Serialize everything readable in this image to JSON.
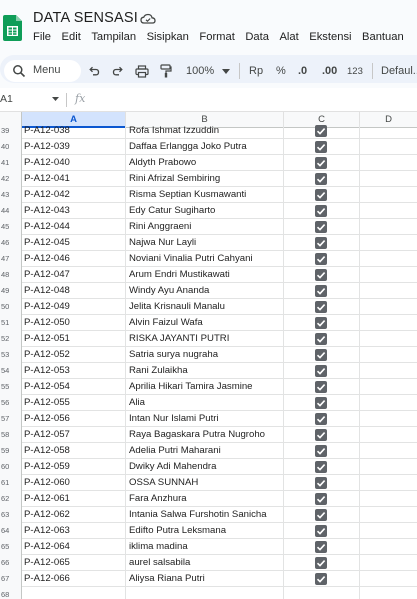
{
  "app": {
    "title": "DATA SENSASI",
    "menu": [
      "File",
      "Edit",
      "Tampilan",
      "Sisipkan",
      "Format",
      "Data",
      "Alat",
      "Ekstensi",
      "Bantuan"
    ]
  },
  "toolbar": {
    "search_label": "Menu",
    "zoom": "100%",
    "currency": "Rp",
    "percent": "%",
    "dec_decrease": ".0",
    "dec_increase": ".00",
    "number_format": "123",
    "font": "Defaul..."
  },
  "formula_bar": {
    "name_box": "A1",
    "fx": "fx"
  },
  "columns": [
    "A",
    "B",
    "C",
    "D"
  ],
  "selected_column": "A",
  "colors": {
    "accent": "#0b57d0",
    "checkbox": "#5f6368",
    "header_bg": "#f8f9fa",
    "logo_green": "#0f9d58"
  },
  "rows": [
    {
      "num": "39",
      "code": "P-A12-038",
      "name": "Rofa Ishmat Izzuddin",
      "checked": true
    },
    {
      "num": "40",
      "code": "P-A12-039",
      "name": "Daffaa Erlangga Joko Putra",
      "checked": true
    },
    {
      "num": "41",
      "code": "P-A12-040",
      "name": "Aldyth Prabowo",
      "checked": true
    },
    {
      "num": "42",
      "code": "P-A12-041",
      "name": "Rini Afrizal Sembiring",
      "checked": true
    },
    {
      "num": "43",
      "code": "P-A12-042",
      "name": "Risma Septian Kusmawanti",
      "checked": true
    },
    {
      "num": "44",
      "code": "P-A12-043",
      "name": "Edy Catur Sugiharto",
      "checked": true
    },
    {
      "num": "45",
      "code": "P-A12-044",
      "name": "Rini Anggraeni",
      "checked": true
    },
    {
      "num": "46",
      "code": "P-A12-045",
      "name": "Najwa Nur Layli",
      "checked": true
    },
    {
      "num": "47",
      "code": "P-A12-046",
      "name": "Noviani Vinalia Putri Cahyani",
      "checked": true
    },
    {
      "num": "48",
      "code": "P-A12-047",
      "name": "Arum Endri Mustikawati",
      "checked": true
    },
    {
      "num": "49",
      "code": "P-A12-048",
      "name": "Windy Ayu Ananda",
      "checked": true
    },
    {
      "num": "50",
      "code": "P-A12-049",
      "name": "Jelita Krisnauli Manalu",
      "checked": true
    },
    {
      "num": "51",
      "code": "P-A12-050",
      "name": "Alvin Faizul Wafa",
      "checked": true
    },
    {
      "num": "52",
      "code": "P-A12-051",
      "name": "RISKA JAYANTI PUTRI",
      "checked": true
    },
    {
      "num": "53",
      "code": "P-A12-052",
      "name": "Satria surya nugraha",
      "checked": true
    },
    {
      "num": "54",
      "code": "P-A12-053",
      "name": "Rani Zulaikha",
      "checked": true
    },
    {
      "num": "55",
      "code": "P-A12-054",
      "name": "Aprilia Hikari Tamira Jasmine",
      "checked": true
    },
    {
      "num": "56",
      "code": "P-A12-055",
      "name": "Alia",
      "checked": true
    },
    {
      "num": "57",
      "code": "P-A12-056",
      "name": "Intan Nur Islami Putri",
      "checked": true
    },
    {
      "num": "58",
      "code": "P-A12-057",
      "name": "Raya Bagaskara Putra Nugroho",
      "checked": true
    },
    {
      "num": "59",
      "code": "P-A12-058",
      "name": "Adelia Putri Maharani",
      "checked": true
    },
    {
      "num": "60",
      "code": "P-A12-059",
      "name": "Dwiky Adi Mahendra",
      "checked": true
    },
    {
      "num": "61",
      "code": "P-A12-060",
      "name": "OSSA SUNNAH",
      "checked": true
    },
    {
      "num": "62",
      "code": "P-A12-061",
      "name": "Fara Anzhura",
      "checked": true
    },
    {
      "num": "63",
      "code": "P-A12-062",
      "name": "Intania Salwa Furshotin Sanicha",
      "checked": true
    },
    {
      "num": "64",
      "code": "P-A12-063",
      "name": "Edifto Putra Leksmana",
      "checked": true
    },
    {
      "num": "65",
      "code": "P-A12-064",
      "name": "iklima madina",
      "checked": true
    },
    {
      "num": "66",
      "code": "P-A12-065",
      "name": "aurel salsabila",
      "checked": true
    },
    {
      "num": "67",
      "code": "P-A12-066",
      "name": "Aliysa Riana Putri",
      "checked": true
    },
    {
      "num": "68",
      "code": "",
      "name": "",
      "checked": false
    }
  ]
}
